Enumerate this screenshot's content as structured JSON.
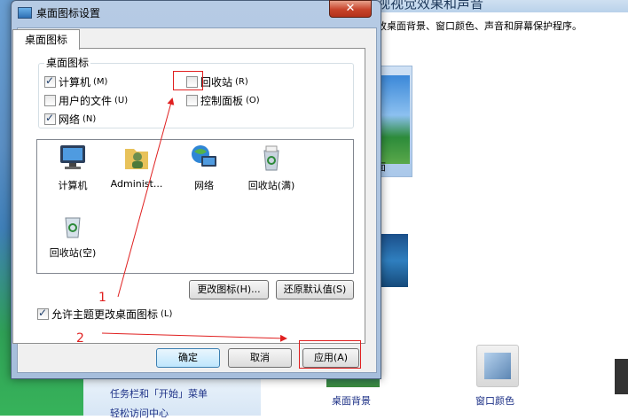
{
  "background_window": {
    "heading": "视视觉效果和声音",
    "description": "改桌面背景、窗口颜色、声音和屏幕保护程序。",
    "theme_label": "面",
    "left_links": [
      "任务栏和「开始」菜单",
      "轻松访问中心"
    ],
    "bottom_items": [
      "桌面背景",
      "窗口颜色"
    ]
  },
  "dialog": {
    "title": "桌面图标设置",
    "close_label": "✕",
    "tab": "桌面图标",
    "group_title": "桌面图标",
    "checkboxes": [
      {
        "label": "计算机",
        "accel": "(M)",
        "checked": true
      },
      {
        "label": "用户的文件",
        "accel": "(U)",
        "checked": false
      },
      {
        "label": "网络",
        "accel": "(N)",
        "checked": true
      },
      {
        "label": "回收站",
        "accel": "(R)",
        "checked": false
      },
      {
        "label": "控制面板",
        "accel": "(O)",
        "checked": false
      }
    ],
    "icons": [
      {
        "label": "计算机",
        "icon": "computer-icon"
      },
      {
        "label": "Administ...",
        "icon": "user-folder-icon"
      },
      {
        "label": "网络",
        "icon": "network-icon"
      },
      {
        "label": "回收站(满)",
        "icon": "recycle-bin-full-icon"
      },
      {
        "label": "回收站(空)",
        "icon": "recycle-bin-empty-icon"
      }
    ],
    "change_icon_button": "更改图标(H)...",
    "restore_default_button": "还原默认值(S)",
    "allow_themes": {
      "label": "允许主题更改桌面图标",
      "accel": "(L)",
      "checked": true
    },
    "ok_button": "确定",
    "cancel_button": "取消",
    "apply_button": "应用(A)"
  },
  "annotations": {
    "step1": "1",
    "step2": "2"
  },
  "colors": {
    "annotation_red": "#e02020",
    "titlebar": "#b6cbe4",
    "link": "#1e3287"
  }
}
